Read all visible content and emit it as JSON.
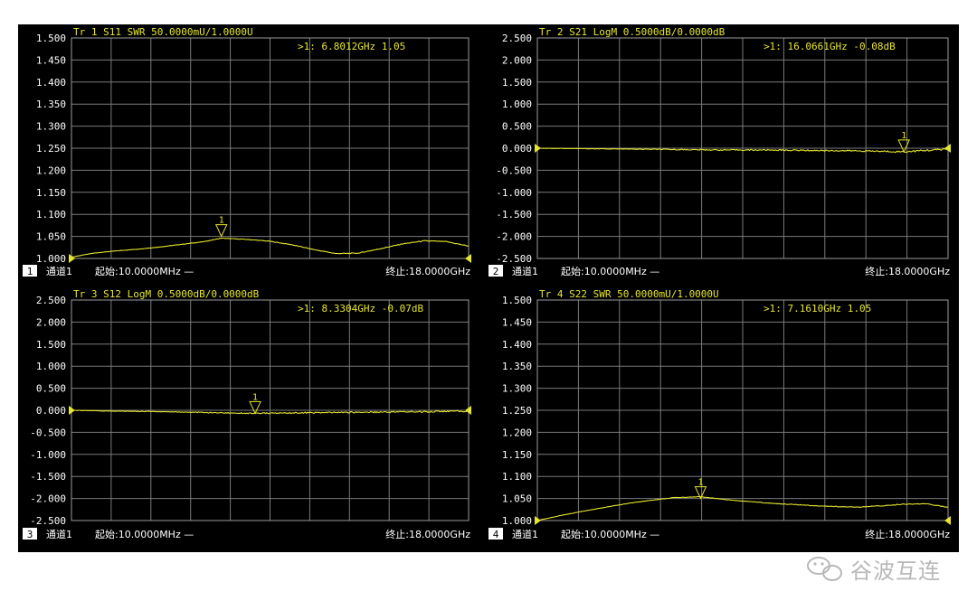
{
  "charts": [
    {
      "trace": "Tr 1  S11 SWR 50.0000mU/1.0000U",
      "marker_readout": ">1:   6.8012GHz 1.05",
      "panel_number": "1",
      "channel": "通道1",
      "start": "起始:10.0000MHz —",
      "stop": "终止:18.0000GHz",
      "yticks": [
        "1.500",
        "1.450",
        "1.400",
        "1.350",
        "1.300",
        "1.250",
        "1.200",
        "1.150",
        "1.100",
        "1.050",
        "1.000"
      ],
      "marker_label": "1"
    },
    {
      "trace": "Tr 2  S21 LogM 0.5000dB/0.0000dB",
      "marker_readout": ">1:   16.0661GHz -0.08dB",
      "panel_number": "2",
      "channel": "通道1",
      "start": "起始:10.0000MHz —",
      "stop": "终止:18.0000GHz",
      "yticks": [
        "2.500",
        "2.000",
        "1.500",
        "1.000",
        "0.500",
        "0.000",
        "-0.500",
        "-1.000",
        "-1.500",
        "-2.000",
        "-2.500"
      ],
      "marker_label": "1"
    },
    {
      "trace": "Tr 3  S12 LogM 0.5000dB/0.0000dB",
      "marker_readout": ">1:   8.3304GHz -0.07dB",
      "panel_number": "3",
      "channel": "通道1",
      "start": "起始:10.0000MHz —",
      "stop": "终止:18.0000GHz",
      "yticks": [
        "2.500",
        "2.000",
        "1.500",
        "1.000",
        "0.500",
        "0.000",
        "-0.500",
        "-1.000",
        "-1.500",
        "-2.000",
        "-2.500"
      ],
      "marker_label": "1"
    },
    {
      "trace": "Tr 4  S22 SWR 50.0000mU/1.0000U",
      "marker_readout": ">1:   7.1610GHz 1.05",
      "panel_number": "4",
      "channel": "通道1",
      "start": "起始:10.0000MHz —",
      "stop": "终止:18.0000GHz",
      "yticks": [
        "1.500",
        "1.450",
        "1.400",
        "1.350",
        "1.300",
        "1.250",
        "1.200",
        "1.150",
        "1.100",
        "1.050",
        "1.000"
      ],
      "marker_label": "1"
    }
  ],
  "chart_data": [
    {
      "type": "line",
      "title": "Tr 1  S11 SWR 50.0000mU/1.0000U",
      "xlim": [
        0.01,
        18.0
      ],
      "ylim": [
        1.0,
        1.5
      ],
      "grid": true,
      "series": [
        {
          "x": [
            0.01,
            1,
            2,
            3,
            4,
            5,
            6,
            6.8012,
            8,
            9,
            10,
            11,
            12,
            13,
            14,
            15,
            16,
            17,
            18
          ],
          "y": [
            1.003,
            1.012,
            1.017,
            1.021,
            1.026,
            1.032,
            1.038,
            1.046,
            1.043,
            1.039,
            1.031,
            1.02,
            1.011,
            1.012,
            1.022,
            1.033,
            1.04,
            1.038,
            1.028
          ]
        }
      ],
      "marker": {
        "x": 6.8012,
        "y": 1.05
      },
      "color": "#e6e62e"
    },
    {
      "type": "line",
      "title": "Tr 2  S21 LogM 0.5000dB/0.0000dB",
      "xlim": [
        0.01,
        18.0
      ],
      "ylim": [
        -2.5,
        2.5
      ],
      "grid": true,
      "series": [
        {
          "x": [
            0.01,
            2,
            4,
            6,
            8,
            10,
            12,
            14,
            16.0661,
            18
          ],
          "y": [
            0.0,
            -0.01,
            -0.02,
            -0.03,
            -0.04,
            -0.04,
            -0.05,
            -0.06,
            -0.08,
            -0.02
          ]
        }
      ],
      "marker": {
        "x": 16.0661,
        "y": -0.08
      },
      "color": "#e6e62e"
    },
    {
      "type": "line",
      "title": "Tr 3  S12 LogM 0.5000dB/0.0000dB",
      "xlim": [
        0.01,
        18.0
      ],
      "ylim": [
        -2.5,
        2.5
      ],
      "grid": true,
      "series": [
        {
          "x": [
            0.01,
            2,
            4,
            6,
            8.3304,
            10,
            12,
            14,
            16,
            18
          ],
          "y": [
            0.0,
            -0.02,
            -0.03,
            -0.05,
            -0.07,
            -0.06,
            -0.05,
            -0.04,
            -0.03,
            -0.02
          ]
        }
      ],
      "marker": {
        "x": 8.3304,
        "y": -0.07
      },
      "color": "#e6e62e"
    },
    {
      "type": "line",
      "title": "Tr 4  S22 SWR 50.0000mU/1.0000U",
      "xlim": [
        0.01,
        18.0
      ],
      "ylim": [
        1.0,
        1.5
      ],
      "grid": true,
      "series": [
        {
          "x": [
            0.01,
            1,
            2,
            3,
            4,
            5,
            6,
            7.161,
            8,
            9,
            10,
            11,
            12,
            13,
            14,
            15,
            16,
            17,
            18
          ],
          "y": [
            1.0,
            1.011,
            1.021,
            1.03,
            1.039,
            1.046,
            1.052,
            1.054,
            1.049,
            1.044,
            1.04,
            1.037,
            1.034,
            1.032,
            1.03,
            1.033,
            1.037,
            1.038,
            1.03
          ]
        }
      ],
      "marker": {
        "x": 7.161,
        "y": 1.05
      },
      "color": "#e6e62e"
    }
  ],
  "watermark": "谷波互连"
}
